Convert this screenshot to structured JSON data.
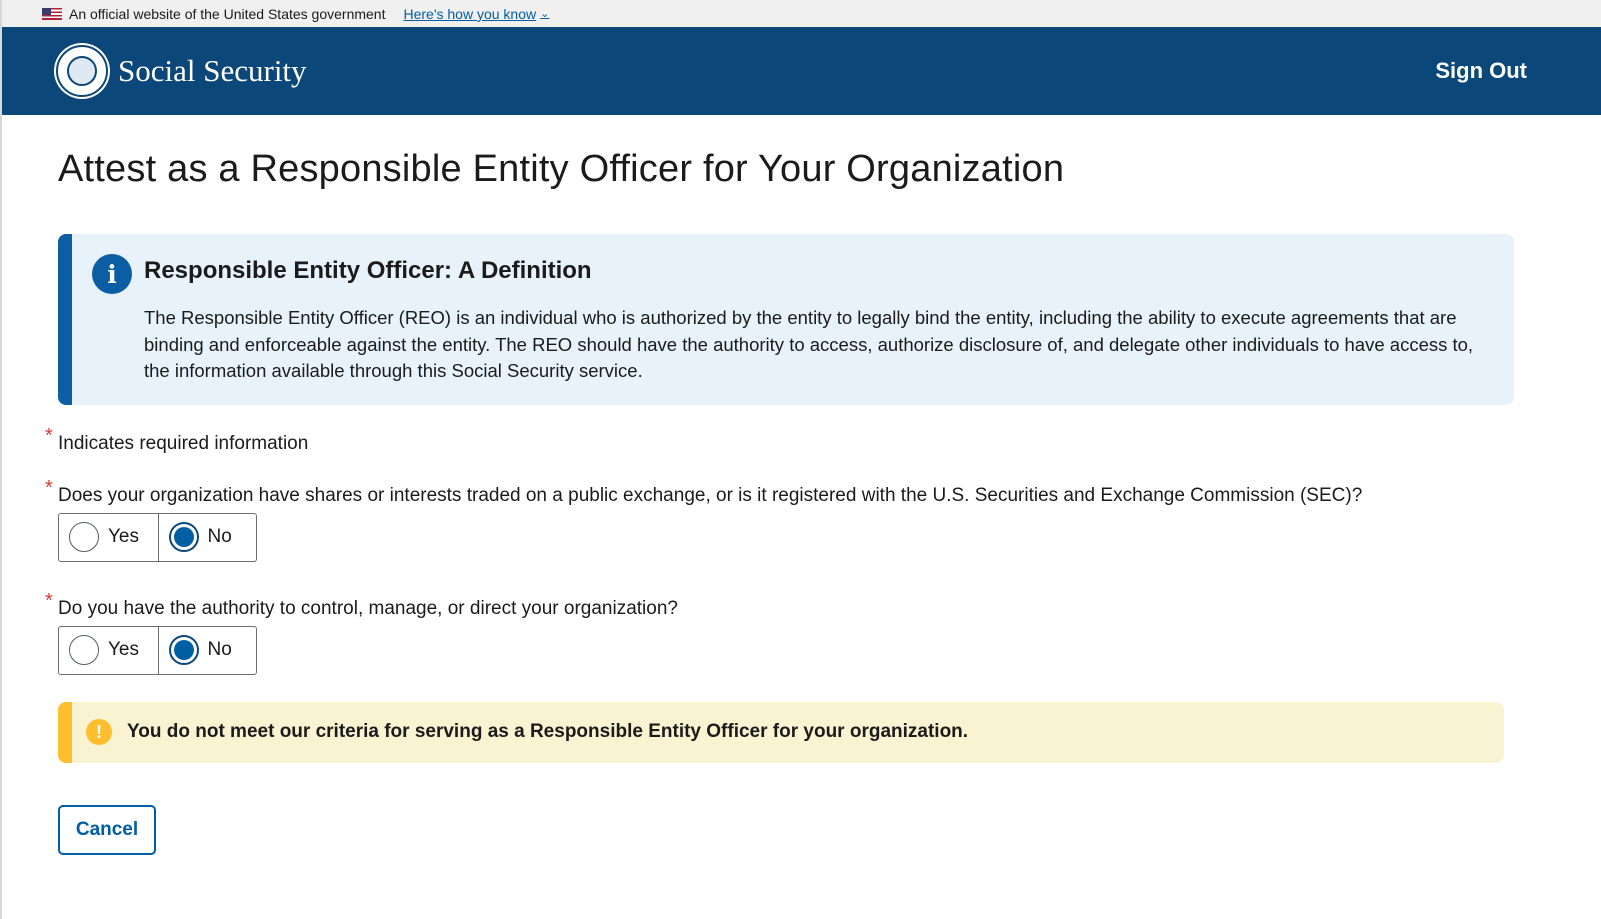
{
  "gov_banner": {
    "text": "An official website of the United States government",
    "link": "Here's how you know",
    "chevron": "⌄"
  },
  "header": {
    "brand": "Social Security",
    "sign_out": "Sign Out"
  },
  "page_title": "Attest as a Responsible Entity Officer for Your Organization",
  "info_alert": {
    "icon": "i",
    "heading": "Responsible Entity Officer: A Definition",
    "body": "The Responsible Entity Officer (REO) is an individual who is authorized by the entity to legally bind the entity, including the ability to execute agreements that are binding and enforceable against the entity. The REO should have the authority to access, authorize disclosure of, and delegate other individuals to have access to, the information available through this Social Security service."
  },
  "required_note": {
    "asterisk": "*",
    "text": "Indicates required information"
  },
  "questions": [
    {
      "text": "Does your organization have shares or interests traded on a public exchange, or is it registered with the U.S. Securities and Exchange Commission (SEC)?",
      "options": [
        "Yes",
        "No"
      ],
      "selected": "No"
    },
    {
      "text": "Do you have the authority to control, manage, or direct your organization?",
      "options": [
        "Yes",
        "No"
      ],
      "selected": "No"
    }
  ],
  "warning_alert": {
    "icon": "!",
    "text": "You do not meet our criteria for serving as a Responsible Entity Officer for your organization."
  },
  "cancel_button": "Cancel",
  "colors": {
    "header_bg": "#0b4778",
    "info_border": "#0b5ea4",
    "info_bg": "#e7f2fb",
    "warning_border": "#ffbe2e",
    "warning_bg": "#faf3d1",
    "required": "#d83933",
    "link": "#005ea2"
  }
}
